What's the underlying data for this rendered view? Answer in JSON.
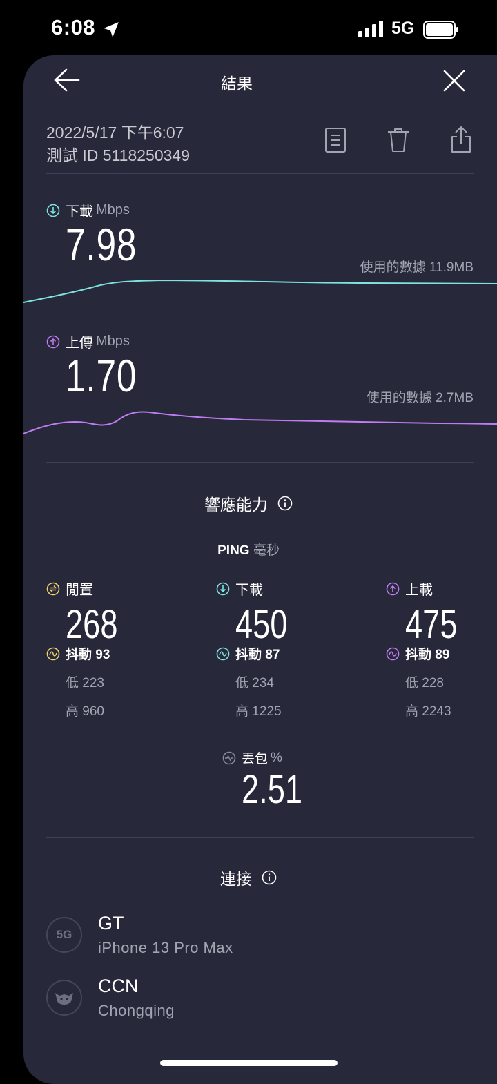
{
  "status_bar": {
    "time": "6:08",
    "network": "5G"
  },
  "header": {
    "title": "結果"
  },
  "test": {
    "date": "2022/5/17 下午6:07",
    "id_label": "測試 ID 5118250349"
  },
  "download": {
    "label": "下載",
    "unit": "Mbps",
    "value": "7.98",
    "data_used": "使用的數據 11.9MB",
    "color": "#7fe3e0"
  },
  "upload": {
    "label": "上傳",
    "unit": "Mbps",
    "value": "1.70",
    "data_used": "使用的數據 2.7MB",
    "color": "#c07cf2"
  },
  "responsiveness": {
    "title": "響應能力",
    "ping_label": "PING",
    "ping_unit": "毫秒",
    "columns": [
      {
        "label": "閒置",
        "value": "268",
        "jitter": "抖動 93",
        "low": "低 223",
        "high": "高 960",
        "color": "#f1d36d"
      },
      {
        "label": "下載",
        "value": "450",
        "jitter": "抖動 87",
        "low": "低 234",
        "high": "高 1225",
        "color": "#7fe3e0"
      },
      {
        "label": "上載",
        "value": "475",
        "jitter": "抖動 89",
        "low": "低 228",
        "high": "高 2243",
        "color": "#c07cf2"
      }
    ],
    "packet_loss": {
      "label": "丟包",
      "unit": "%",
      "value": "2.51"
    }
  },
  "connections": {
    "title": "連接",
    "items": [
      {
        "name": "GT",
        "detail": "iPhone 13 Pro Max",
        "icon_text": "5G"
      },
      {
        "name": "CCN",
        "detail": "Chongqing"
      }
    ]
  }
}
